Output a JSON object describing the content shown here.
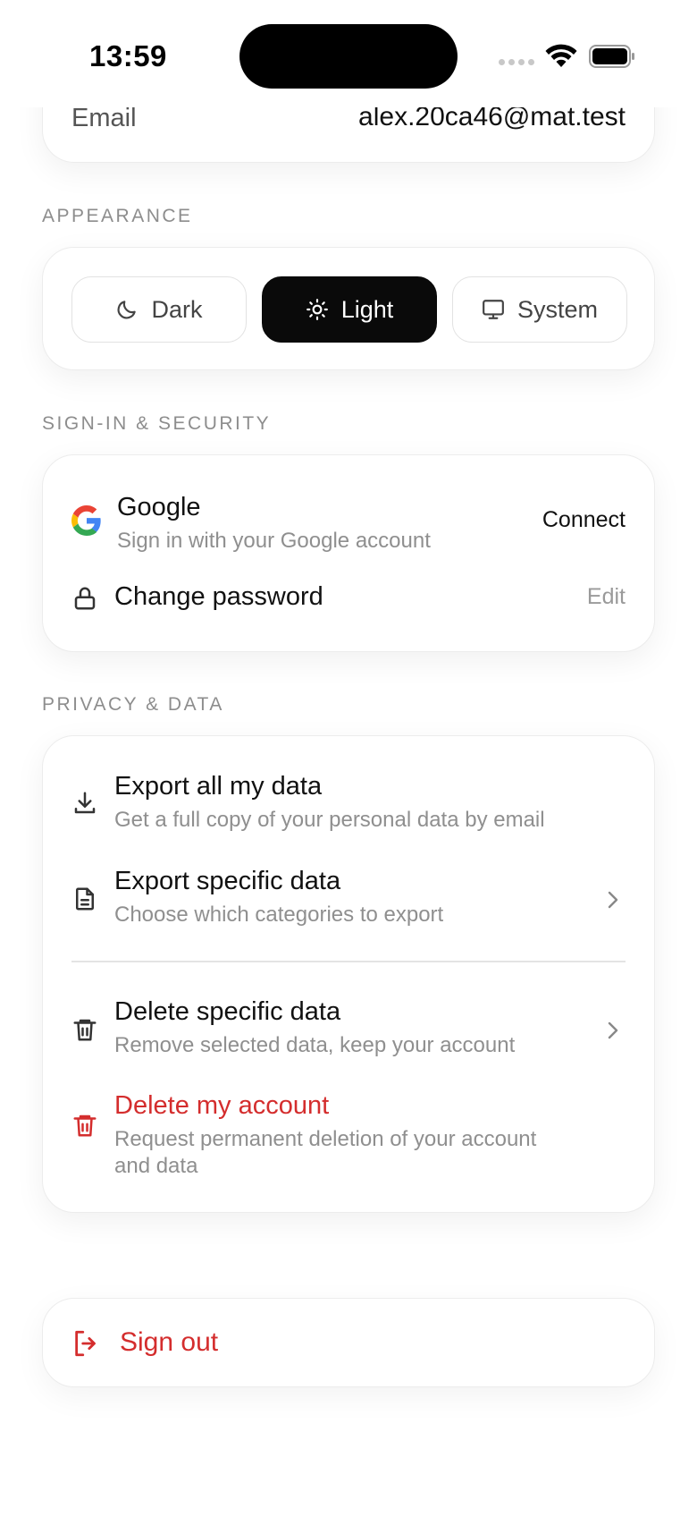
{
  "status": {
    "time": "13:59"
  },
  "account": {
    "email_label": "Email",
    "email_value": "alex.20ca46@mat.test"
  },
  "appearance": {
    "label": "APPEARANCE",
    "options": [
      {
        "label": "Dark",
        "icon": "moon-icon",
        "selected": false
      },
      {
        "label": "Light",
        "icon": "sun-icon",
        "selected": true
      },
      {
        "label": "System",
        "icon": "monitor-icon",
        "selected": false
      }
    ]
  },
  "security": {
    "label": "SIGN-IN & SECURITY",
    "google": {
      "title": "Google",
      "subtitle": "Sign in with your Google account",
      "action": "Connect"
    },
    "password": {
      "title": "Change password",
      "action": "Edit"
    }
  },
  "privacy": {
    "label": "PRIVACY & DATA",
    "items": [
      {
        "title": "Export all my data",
        "subtitle": "Get a full copy of your personal data by email",
        "icon": "download-icon"
      },
      {
        "title": "Export specific data",
        "subtitle": "Choose which categories to export",
        "icon": "document-icon"
      },
      {
        "title": "Delete specific data",
        "subtitle": "Remove selected data, keep your account",
        "icon": "trash-icon"
      },
      {
        "title": "Delete my account",
        "subtitle_line1": "Request permanent deletion of your account",
        "subtitle_line2": "and data",
        "icon": "trash-icon"
      }
    ]
  },
  "signout": {
    "label": "Sign out",
    "icon": "logout-icon"
  },
  "colors": {
    "danger": "#d42d2d",
    "active": "#0a0a0a",
    "muted": "#8f8f8f"
  }
}
